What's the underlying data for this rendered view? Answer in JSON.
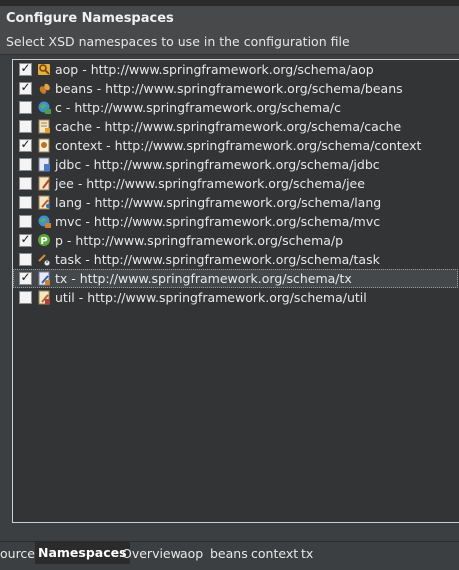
{
  "dialog": {
    "title": "Configure Namespaces",
    "subtitle": "Select XSD namespaces to use in the configuration file"
  },
  "namespaces": [
    {
      "label": "aop - http://www.springframework.org/schema/aop",
      "checked": true,
      "icon": "aop-icon",
      "check_mark": "✓"
    },
    {
      "label": "beans - http://www.springframework.org/schema/beans",
      "checked": true,
      "icon": "beans-icon",
      "check_mark": "✓"
    },
    {
      "label": "c - http://www.springframework.org/schema/c",
      "checked": false,
      "icon": "c-globe-icon",
      "check_mark": ""
    },
    {
      "label": "cache - http://www.springframework.org/schema/cache",
      "checked": false,
      "icon": "cache-icon",
      "check_mark": ""
    },
    {
      "label": "context - http://www.springframework.org/schema/context",
      "checked": true,
      "icon": "context-icon",
      "check_mark": "✓"
    },
    {
      "label": "jdbc - http://www.springframework.org/schema/jdbc",
      "checked": false,
      "icon": "jdbc-icon",
      "check_mark": ""
    },
    {
      "label": "jee - http://www.springframework.org/schema/jee",
      "checked": false,
      "icon": "jee-icon",
      "check_mark": ""
    },
    {
      "label": "lang - http://www.springframework.org/schema/lang",
      "checked": false,
      "icon": "lang-icon",
      "check_mark": ""
    },
    {
      "label": "mvc - http://www.springframework.org/schema/mvc",
      "checked": false,
      "icon": "mvc-globe-icon",
      "check_mark": ""
    },
    {
      "label": "p - http://www.springframework.org/schema/p",
      "checked": true,
      "icon": "p-icon",
      "check_mark": "✓"
    },
    {
      "label": "task - http://www.springframework.org/schema/task",
      "checked": false,
      "icon": "task-icon",
      "check_mark": ""
    },
    {
      "label": "tx - http://www.springframework.org/schema/tx",
      "checked": true,
      "icon": "tx-icon",
      "check_mark": "✓",
      "selected": true
    },
    {
      "label": "util - http://www.springframework.org/schema/util",
      "checked": false,
      "icon": "util-icon",
      "check_mark": ""
    }
  ],
  "tabs": [
    {
      "label": "ource",
      "active": false
    },
    {
      "label": "Namespaces",
      "active": true
    },
    {
      "label": "Overview",
      "active": false
    },
    {
      "label": "aop",
      "active": false
    },
    {
      "label": "beans",
      "active": false
    },
    {
      "label": "context",
      "active": false
    },
    {
      "label": "tx",
      "active": false
    }
  ],
  "colors": {
    "background": "#3c3f41",
    "header": "#47494b",
    "list_background": "#323436",
    "active_tab": "#2b2b2b"
  }
}
